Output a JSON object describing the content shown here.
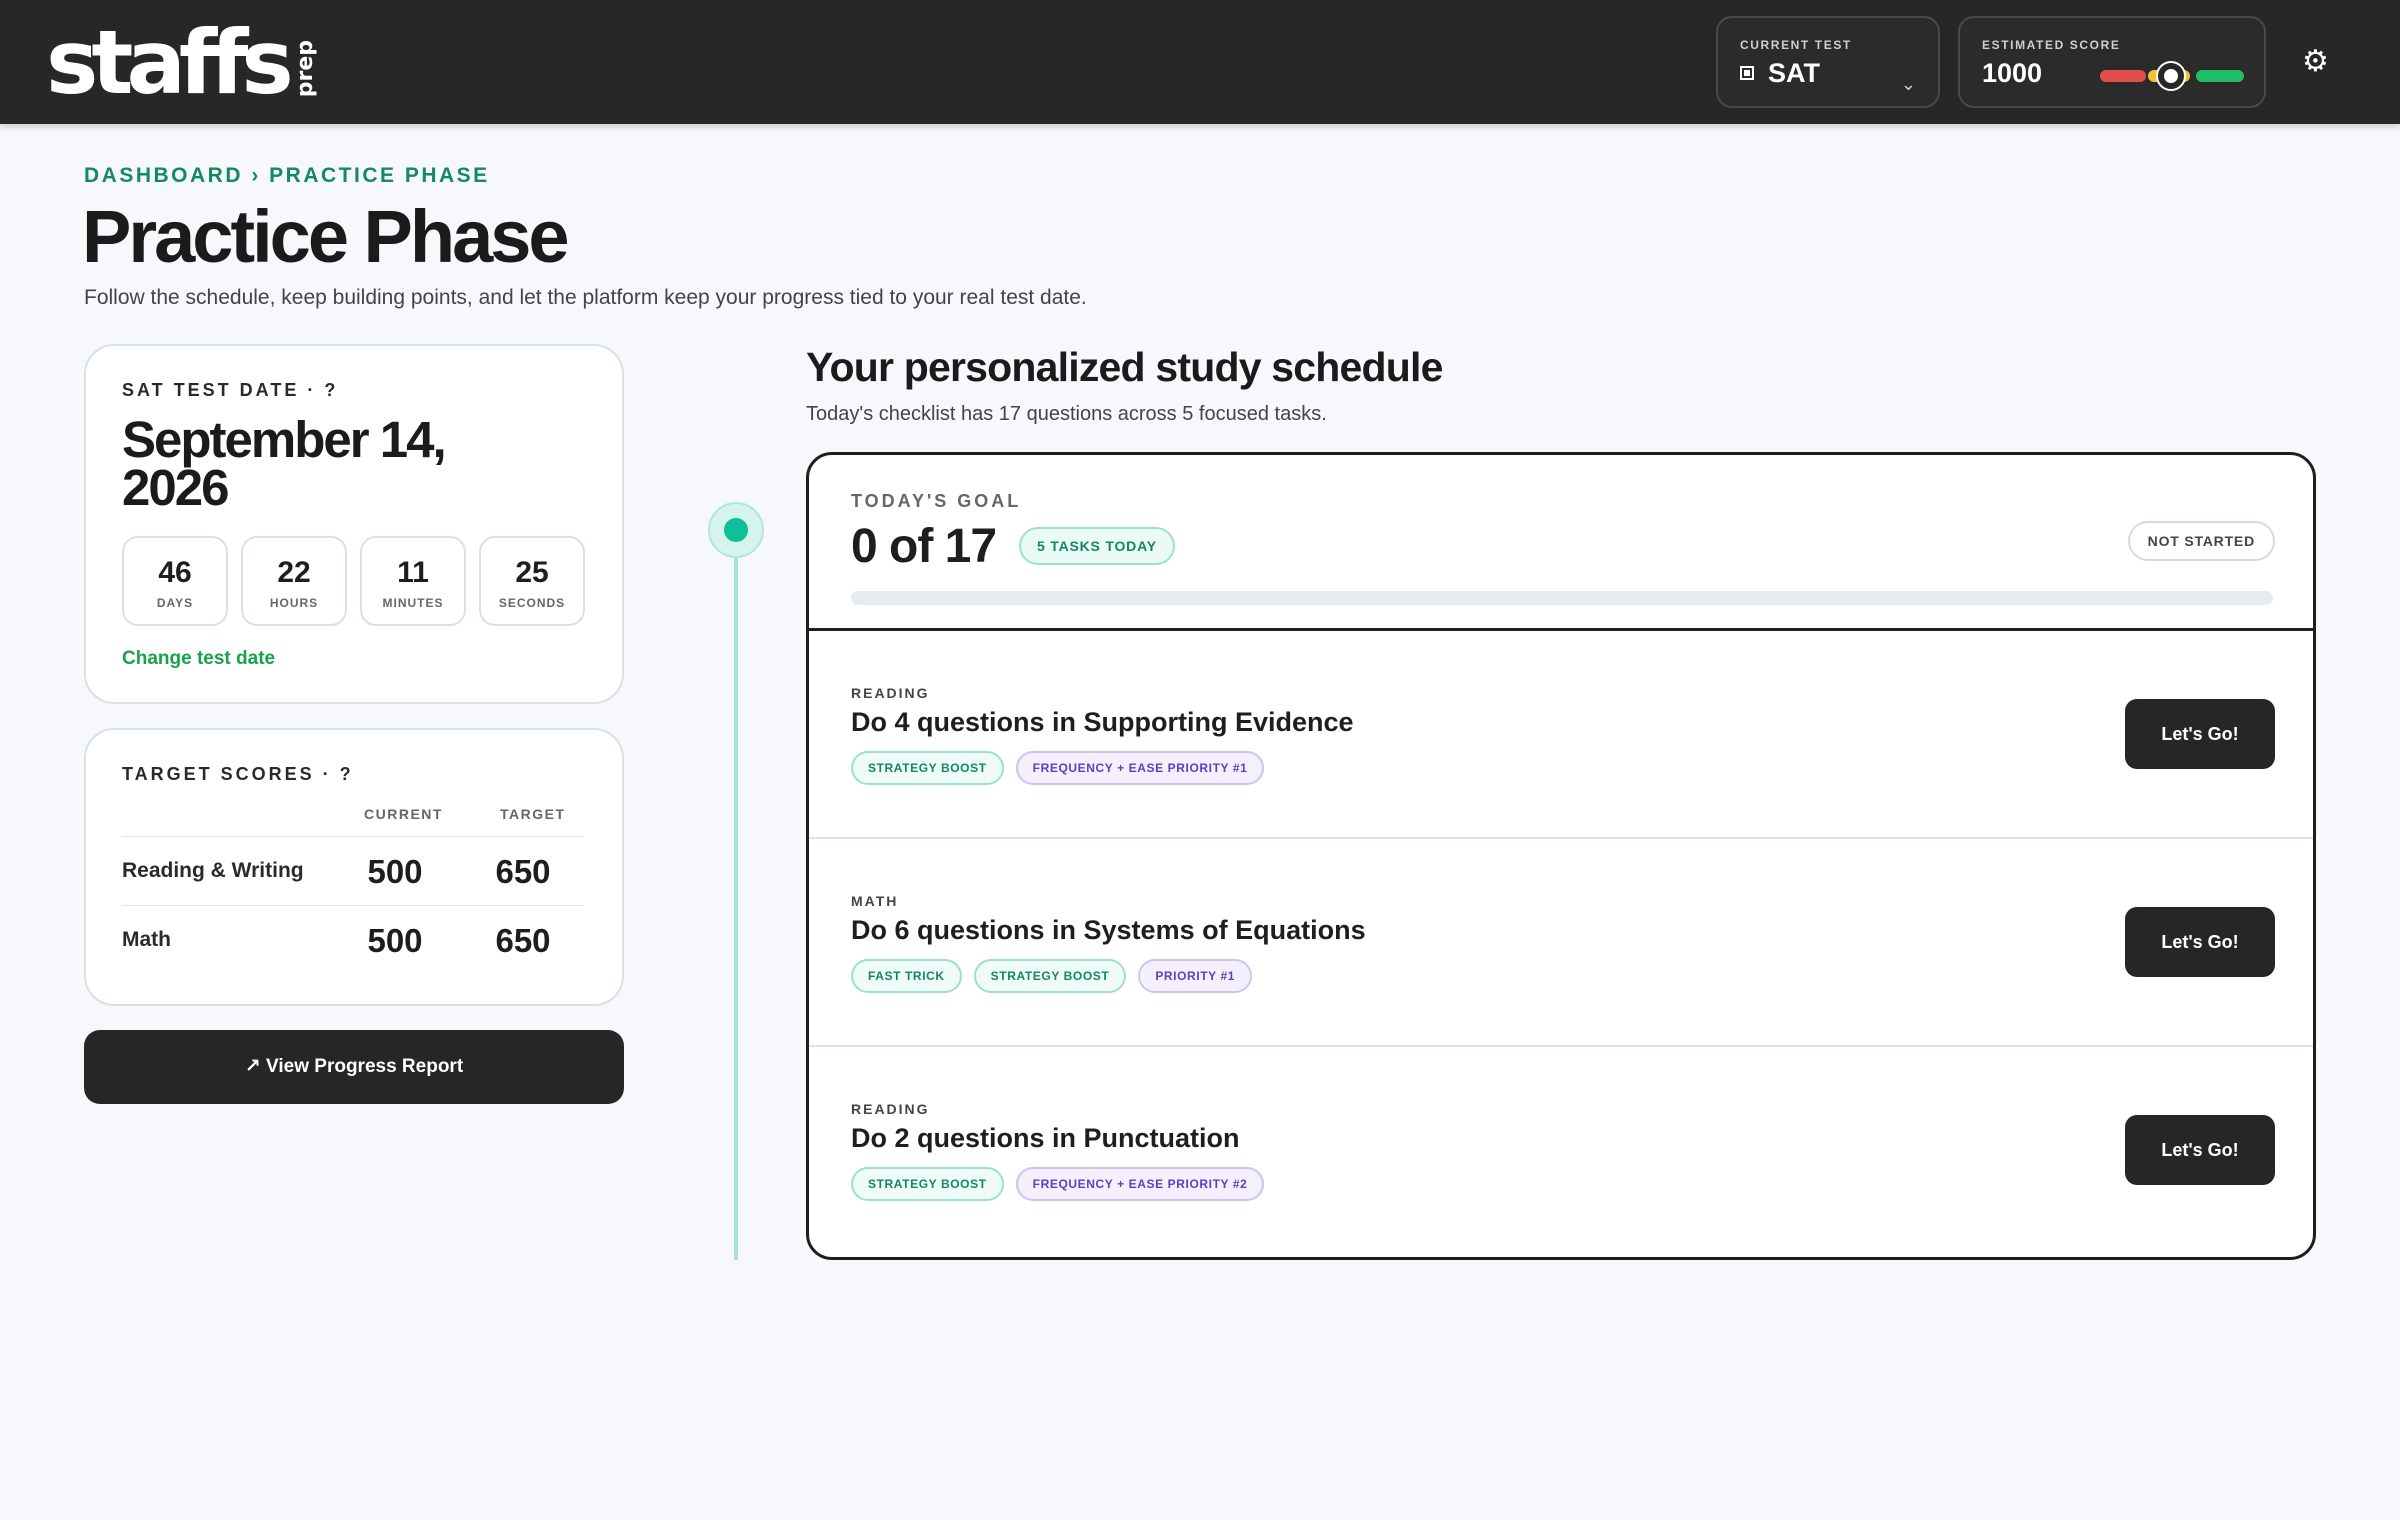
{
  "header": {
    "logo_main": "staffs",
    "logo_sub": "prep",
    "current_test_label": "CURRENT TEST",
    "current_test_value": "SAT",
    "estimated_score_label": "ESTIMATED SCORE",
    "estimated_score_value": "1000",
    "icons": [
      "sat-icon",
      "chevron-down-icon",
      "gear-icon"
    ],
    "score_colors": {
      "low": "#e24d4d",
      "mid": "#f1c232",
      "high": "#1ebd66"
    }
  },
  "page": {
    "breadcrumb": "DASHBOARD › PRACTICE PHASE",
    "title": "Practice Phase",
    "subtitle": "Follow the schedule, keep building points, and let the platform keep your progress tied to your real test date."
  },
  "test_date": {
    "label": "SAT TEST DATE · ?",
    "date": "September 14, 2026",
    "countdown": [
      {
        "value": "46",
        "label": "DAYS"
      },
      {
        "value": "22",
        "label": "HOURS"
      },
      {
        "value": "11",
        "label": "MINUTES"
      },
      {
        "value": "25",
        "label": "SECONDS"
      }
    ],
    "change_link": "Change test date"
  },
  "target_scores": {
    "label": "TARGET SCORES · ?",
    "col_current": "CURRENT",
    "col_target": "TARGET",
    "rows": [
      {
        "subject": "Reading & Writing",
        "current": "500",
        "target": "650"
      },
      {
        "subject": "Math",
        "current": "500",
        "target": "650"
      }
    ]
  },
  "report_button": "↗ View Progress Report",
  "schedule": {
    "title": "Your personalized study schedule",
    "subtitle": "Today's checklist has 17 questions across 5 focused tasks.",
    "goal_label": "TODAY'S GOAL",
    "goal_count": "0 of 17",
    "goal_progress_percent": 0,
    "tasks_badge": "5 TASKS TODAY",
    "status": "NOT STARTED",
    "accent_color": "#0fbf99",
    "tasks": [
      {
        "category": "READING",
        "title": "Do 4 questions in Supporting Evidence",
        "tags": [
          "STRATEGY BOOST",
          "FREQUENCY + EASE PRIORITY #1"
        ],
        "button": "Let's Go!"
      },
      {
        "category": "MATH",
        "title": "Do 6 questions in Systems of Equations",
        "tags": [
          "FAST TRICK",
          "STRATEGY BOOST",
          "PRIORITY #1"
        ],
        "button": "Let's Go!"
      },
      {
        "category": "READING",
        "title": "Do 2 questions in Punctuation",
        "tags": [
          "STRATEGY BOOST",
          "FREQUENCY + EASE PRIORITY #2"
        ],
        "button": "Let's Go!"
      }
    ]
  }
}
